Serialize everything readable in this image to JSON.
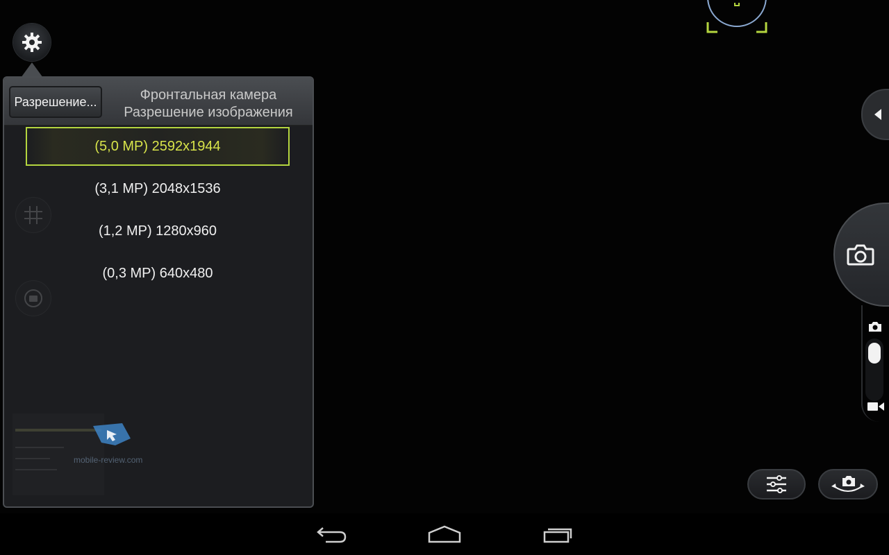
{
  "panel": {
    "back_button": "Разрешение...",
    "title_line1": "Фронтальная камера",
    "title_line2": "Разрешение изображения",
    "options": [
      {
        "label": "(5,0 MP) 2592x1944",
        "selected": true
      },
      {
        "label": "(3,1 MP) 2048x1536",
        "selected": false
      },
      {
        "label": "(1,2 MP) 1280x960",
        "selected": false
      },
      {
        "label": "(0,3 MP) 640x480",
        "selected": false
      }
    ]
  },
  "watermark": "mobile-review.com",
  "colors": {
    "accent": "#b4d53f",
    "selected_text": "#d8e44a",
    "panel_bg": "#1c1d20",
    "reticle_green": "#b4d53f",
    "reticle_blue": "#8aa8d0"
  },
  "icons": {
    "settings": "gear-icon",
    "grid": "grid-icon",
    "camera_mode": "camera-icon",
    "video_mode": "video-icon",
    "filters": "sliders-icon",
    "switch_camera": "switch-camera-icon",
    "nav_back": "back-arrow-icon",
    "nav_home": "home-icon",
    "nav_recent": "recent-apps-icon"
  }
}
